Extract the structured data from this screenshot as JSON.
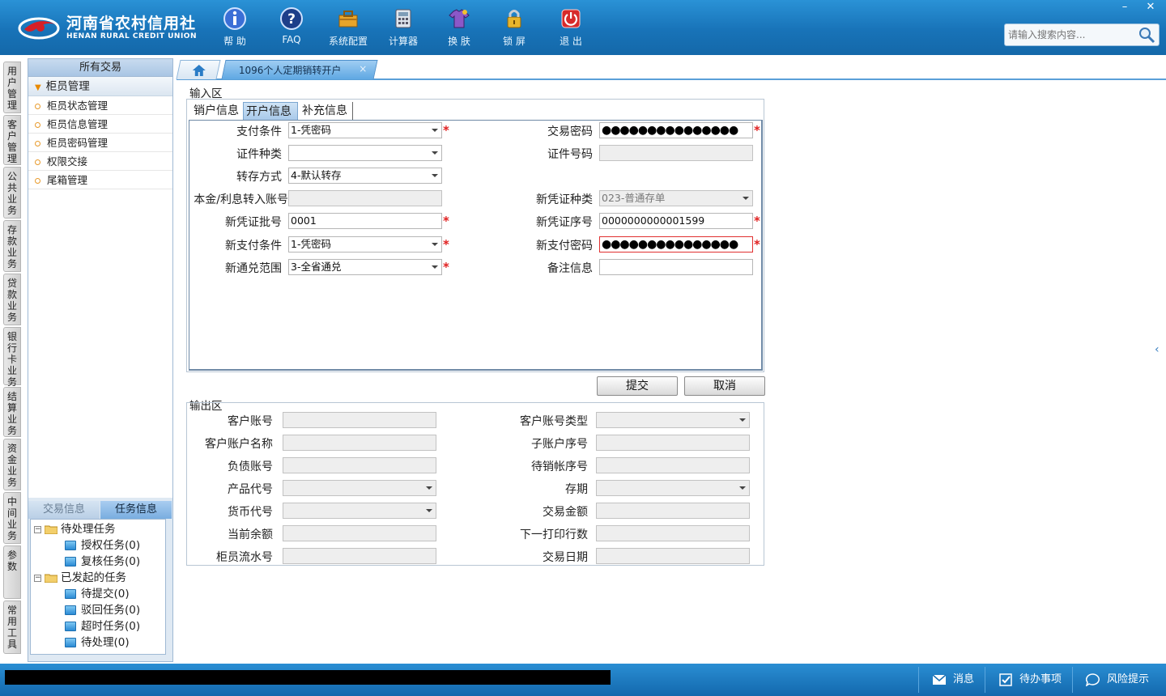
{
  "app": {
    "logo_cn": "河南省农村信用社",
    "logo_en": "HENAN RURAL CREDIT UNION",
    "colors": {
      "header": "#1a7bc4",
      "accent": "#5fa8e3",
      "required": "#e02020"
    }
  },
  "toolbar": [
    {
      "label": "帮 助",
      "icon": "info-icon"
    },
    {
      "label": "FAQ",
      "icon": "question-icon"
    },
    {
      "label": "系统配置",
      "icon": "toolbox-icon"
    },
    {
      "label": "计算器",
      "icon": "calculator-icon"
    },
    {
      "label": "换 肤",
      "icon": "shirt-icon"
    },
    {
      "label": "锁 屏",
      "icon": "lock-icon"
    },
    {
      "label": "退 出",
      "icon": "power-icon"
    }
  ],
  "search": {
    "placeholder": "请输入搜索内容..."
  },
  "window": {
    "minimize": "–",
    "close": "✕"
  },
  "vtabs": [
    "用户管理",
    "客户管理",
    "公共业务",
    "存款业务",
    "贷款业务",
    "银行卡业务",
    "结算业务",
    "资金业务",
    "中间业务",
    "参数",
    "常用工具"
  ],
  "leftpanel": {
    "title": "所有交易",
    "group": "柜员管理",
    "items": [
      "柜员状态管理",
      "柜员信息管理",
      "柜员密码管理",
      "权限交接",
      "尾箱管理"
    ],
    "subtabs": [
      "交易信息",
      "任务信息"
    ],
    "tree": {
      "pending": "待处理任务",
      "pending_children": [
        "授权任务(0)",
        "复核任务(0)"
      ],
      "initiated": "已发起的任务",
      "initiated_children": [
        "待提交(0)",
        "驳回任务(0)",
        "超时任务(0)",
        "待处理(0)"
      ]
    }
  },
  "tabs": {
    "active": "1096个人定期销转开户",
    "close": "×"
  },
  "input": {
    "zone": "输入区",
    "tabs": [
      "销户信息",
      "开户信息",
      "补充信息"
    ],
    "active_tab": "开户信息",
    "left_fields": [
      {
        "label": "支付条件",
        "value": "1-凭密码",
        "type": "select",
        "required": true
      },
      {
        "label": "证件种类",
        "value": "",
        "type": "select",
        "required": false
      },
      {
        "label": "转存方式",
        "value": "4-默认转存",
        "type": "select",
        "required": false
      },
      {
        "label": "本金/利息转入账号",
        "value": "",
        "type": "disabled",
        "required": false
      },
      {
        "label": "新凭证批号",
        "value": "0001",
        "type": "text",
        "required": true
      },
      {
        "label": "新支付条件",
        "value": "1-凭密码",
        "type": "select",
        "required": true
      },
      {
        "label": "新通兑范围",
        "value": "3-全省通兑",
        "type": "select",
        "required": true
      }
    ],
    "right_fields": [
      {
        "label": "交易密码",
        "value": "●●●●●●●●●●●●●●●",
        "type": "password",
        "required": true
      },
      {
        "label": "证件号码",
        "value": "",
        "type": "disabled",
        "required": false
      },
      {
        "label": "新凭证种类",
        "value": "023-普通存单",
        "type": "disabled-select",
        "required": false
      },
      {
        "label": "新凭证序号",
        "value": "0000000000001599",
        "type": "text",
        "required": true
      },
      {
        "label": "新支付密码",
        "value": "●●●●●●●●●●●●●●●",
        "type": "password-err",
        "required": true
      },
      {
        "label": "备注信息",
        "value": "",
        "type": "text",
        "required": false
      }
    ]
  },
  "buttons": {
    "submit": "提交",
    "cancel": "取消"
  },
  "output": {
    "zone": "输出区",
    "left_fields": [
      {
        "label": "客户账号",
        "type": "disabled"
      },
      {
        "label": "客户账户名称",
        "type": "disabled"
      },
      {
        "label": "负债账号",
        "type": "disabled"
      },
      {
        "label": "产品代号",
        "type": "disabled-select"
      },
      {
        "label": "货币代号",
        "type": "disabled-select"
      },
      {
        "label": "当前余额",
        "type": "disabled"
      },
      {
        "label": "柜员流水号",
        "type": "disabled"
      }
    ],
    "right_fields": [
      {
        "label": "客户账号类型",
        "type": "disabled-select"
      },
      {
        "label": "子账户序号",
        "type": "disabled"
      },
      {
        "label": "待销帐序号",
        "type": "disabled"
      },
      {
        "label": "存期",
        "type": "disabled-select"
      },
      {
        "label": "交易金额",
        "type": "disabled"
      },
      {
        "label": "下一打印行数",
        "type": "disabled"
      },
      {
        "label": "交易日期",
        "type": "disabled"
      }
    ]
  },
  "statusbar": [
    {
      "label": "消息",
      "icon": "mail-icon"
    },
    {
      "label": "待办事项",
      "icon": "checkbox-icon"
    },
    {
      "label": "风险提示",
      "icon": "chat-icon"
    }
  ],
  "required_mark": "*",
  "collapse_arrow": "‹"
}
